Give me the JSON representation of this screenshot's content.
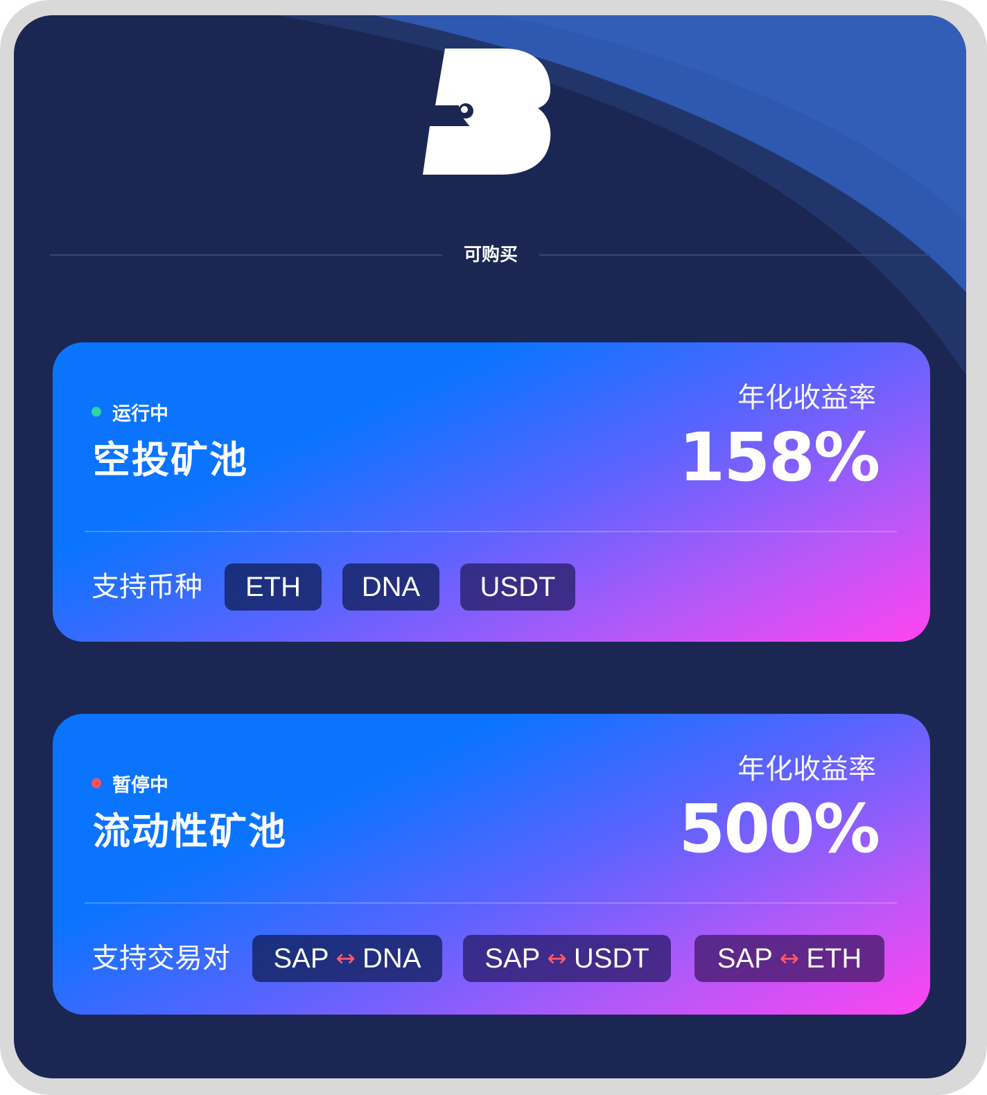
{
  "section": {
    "title": "可购买"
  },
  "pools": [
    {
      "status": "运行中",
      "status_color": "#2fd6a0",
      "name": "空投矿池",
      "rate_label": "年化收益率",
      "rate_value": "158%",
      "support_label": "支持币种",
      "tags": [
        "ETH",
        "DNA",
        "USDT"
      ]
    },
    {
      "status": "暂停中",
      "status_color": "#ff4f5e",
      "name": "流动性矿池",
      "rate_label": "年化收益率",
      "rate_value": "500%",
      "support_label": "支持交易对",
      "pairs": [
        {
          "left": "SAP",
          "arrow": "↔",
          "right": "DNA"
        },
        {
          "left": "SAP",
          "arrow": "↔",
          "right": "USDT"
        },
        {
          "left": "SAP",
          "arrow": "↔",
          "right": "ETH"
        }
      ]
    }
  ],
  "colors": {
    "background": "#1b2752",
    "accent_blue": "#0a74ff",
    "accent_pink": "#ff44f0"
  },
  "icons": {
    "logo": "b-bird-logo-icon",
    "status_dot": "status-dot-icon",
    "swap_arrow": "bidirectional-arrow-icon"
  }
}
